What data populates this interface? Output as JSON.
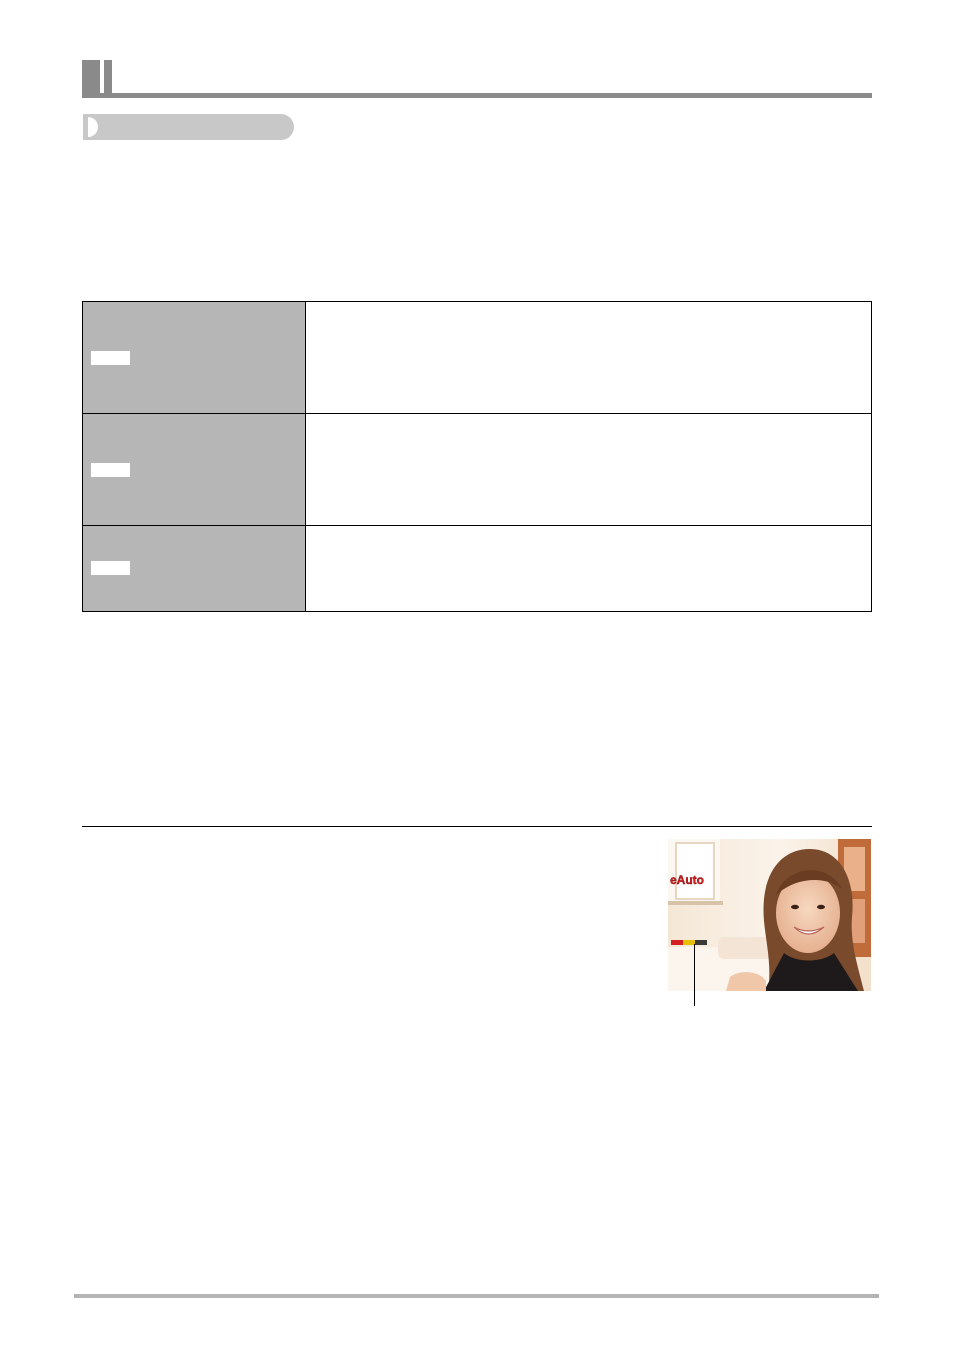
{
  "document": {
    "section_title": "",
    "subsection_title": ""
  },
  "mode_table": {
    "rows": [
      {
        "key_label": "",
        "description": ""
      },
      {
        "key_label": "",
        "description": ""
      },
      {
        "key_label": "",
        "description": ""
      }
    ]
  },
  "preview_photo": {
    "mode_badge": "eAuto",
    "indicator_colors": [
      "#d42020",
      "#e6c000",
      "#3a3a3a"
    ]
  },
  "colors": {
    "header_gray": "#8a8a8a",
    "pill_gray": "#c8c8c8",
    "table_label_gray": "#b6b6b6",
    "footer_gray": "#b4b4b4"
  }
}
